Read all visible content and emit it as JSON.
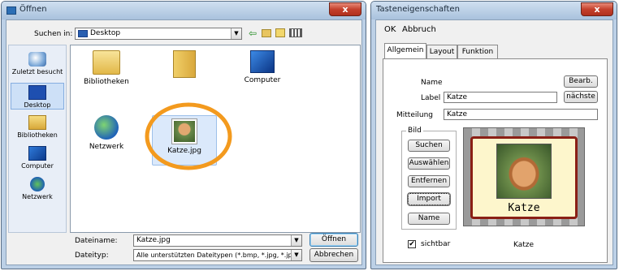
{
  "open_dialog": {
    "title": "Öffnen",
    "close_label": "x",
    "lookin_label": "Suchen in:",
    "lookin_value": "Desktop",
    "places": [
      {
        "label": "Zuletzt besucht",
        "icon": "recent-places-icon"
      },
      {
        "label": "Desktop",
        "icon": "desktop-icon"
      },
      {
        "label": "Bibliotheken",
        "icon": "libraries-icon"
      },
      {
        "label": "Computer",
        "icon": "computer-icon"
      },
      {
        "label": "Netzwerk",
        "icon": "network-icon"
      }
    ],
    "files": [
      {
        "label": "Bibliotheken",
        "icon": "libraries-folder-icon"
      },
      {
        "label": "",
        "icon": "user-folder-icon"
      },
      {
        "label": "Computer",
        "icon": "computer-icon"
      },
      {
        "label": "Netzwerk",
        "icon": "network-icon"
      },
      {
        "label": "Katze.jpg",
        "icon": "image-file-icon"
      }
    ],
    "filename_label": "Dateiname:",
    "filename_value": "Katze.jpg",
    "filetype_label": "Dateityp:",
    "filetype_value": "Alle unterstützten Dateitypen (*.bmp, *.jpg, *.jpe",
    "open_button": "Öffnen",
    "cancel_button": "Abbrechen",
    "highlight_color": "#f39a1e"
  },
  "props_dialog": {
    "title": "Tasteneigenschaften",
    "close_label": "x",
    "menu": [
      "OK",
      "Abbruch"
    ],
    "tabs": [
      "Allgemein",
      "Layout",
      "Funktion"
    ],
    "name_label": "Name",
    "edit_button": "Bearb.",
    "label_label": "Label",
    "label_value": "Katze",
    "next_button": "nächste",
    "message_label": "Mitteilung",
    "message_value": "Katze",
    "image_group": "Bild",
    "image_buttons": [
      "Suchen",
      "Auswählen",
      "Entfernen",
      "Import",
      "Name"
    ],
    "preview_caption": "Katze",
    "visible_label": "sichtbar",
    "visible_checked": true,
    "image_name": "Katze"
  }
}
